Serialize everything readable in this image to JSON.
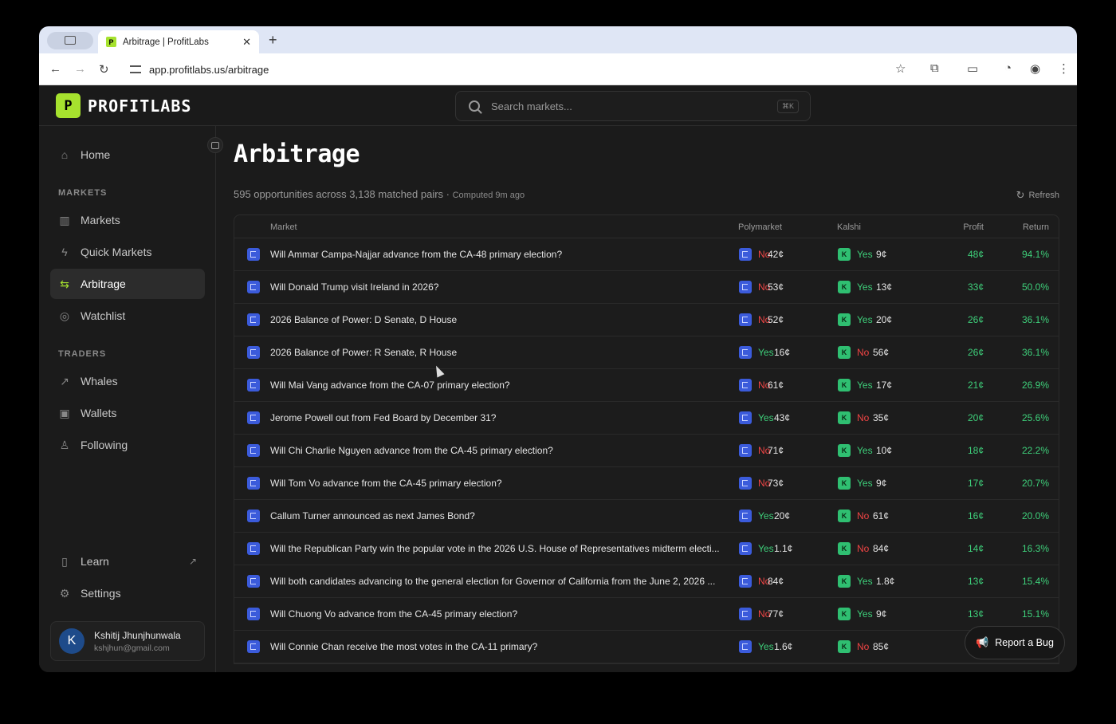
{
  "browser": {
    "tab_title": "Arbitrage | ProfitLabs",
    "favicon_letter": "P",
    "url": "app.profitlabs.us/arbitrage"
  },
  "app": {
    "logo_letter": "P",
    "logo_text": "PROFITLABS",
    "search_placeholder": "Search markets...",
    "search_shortcut": "⌘K",
    "accent_color": "#a6e22e"
  },
  "sidebar": {
    "home": "Home",
    "markets_section": "MARKETS",
    "markets": "Markets",
    "quick_markets": "Quick Markets",
    "arbitrage": "Arbitrage",
    "watchlist": "Watchlist",
    "traders_section": "TRADERS",
    "whales": "Whales",
    "wallets": "Wallets",
    "following": "Following",
    "learn": "Learn",
    "settings": "Settings",
    "user": {
      "initial": "K",
      "name": "Kshitij Jhunjhunwala",
      "email": "kshjhun@gmail.com"
    }
  },
  "main": {
    "title": "Arbitrage",
    "subtitle": "595 opportunities across 3,138 matched pairs",
    "separator": " · ",
    "computed": "Computed 9m ago",
    "refresh": "Refresh",
    "columns": {
      "market": "Market",
      "polymarket": "Polymarket",
      "kalshi": "Kalshi",
      "profit": "Profit",
      "return": "Return"
    },
    "rows": [
      {
        "market": "Will Ammar Campa-Najjar advance from the CA-48 primary election?",
        "pm_side": "No",
        "pm_price": "42¢",
        "k_side": "Yes",
        "k_price": "9¢",
        "profit": "48¢",
        "return": "94.1%"
      },
      {
        "market": "Will Donald Trump visit Ireland in 2026?",
        "pm_side": "No",
        "pm_price": "53¢",
        "k_side": "Yes",
        "k_price": "13¢",
        "profit": "33¢",
        "return": "50.0%"
      },
      {
        "market": "2026 Balance of Power: D Senate, D House",
        "pm_side": "No",
        "pm_price": "52¢",
        "k_side": "Yes",
        "k_price": "20¢",
        "profit": "26¢",
        "return": "36.1%"
      },
      {
        "market": "2026 Balance of Power: R Senate, R House",
        "pm_side": "Yes",
        "pm_price": "16¢",
        "k_side": "No",
        "k_price": "56¢",
        "profit": "26¢",
        "return": "36.1%"
      },
      {
        "market": "Will Mai Vang advance from the CA-07 primary election?",
        "pm_side": "No",
        "pm_price": "61¢",
        "k_side": "Yes",
        "k_price": "17¢",
        "profit": "21¢",
        "return": "26.9%"
      },
      {
        "market": "Jerome Powell out from Fed Board by December 31?",
        "pm_side": "Yes",
        "pm_price": "43¢",
        "k_side": "No",
        "k_price": "35¢",
        "profit": "20¢",
        "return": "25.6%"
      },
      {
        "market": "Will Chi Charlie Nguyen advance from the CA-45 primary election?",
        "pm_side": "No",
        "pm_price": "71¢",
        "k_side": "Yes",
        "k_price": "10¢",
        "profit": "18¢",
        "return": "22.2%"
      },
      {
        "market": "Will Tom Vo advance from the CA-45 primary election?",
        "pm_side": "No",
        "pm_price": "73¢",
        "k_side": "Yes",
        "k_price": "9¢",
        "profit": "17¢",
        "return": "20.7%"
      },
      {
        "market": "Callum Turner announced as next James Bond?",
        "pm_side": "Yes",
        "pm_price": "20¢",
        "k_side": "No",
        "k_price": "61¢",
        "profit": "16¢",
        "return": "20.0%"
      },
      {
        "market": "Will the Republican Party win the popular vote in the 2026 U.S. House of Representatives midterm electi...",
        "pm_side": "Yes",
        "pm_price": "1.1¢",
        "k_side": "No",
        "k_price": "84¢",
        "profit": "14¢",
        "return": "16.3%"
      },
      {
        "market": "Will both candidates advancing to the general election for Governor of California from the June 2, 2026 ...",
        "pm_side": "No",
        "pm_price": "84¢",
        "k_side": "Yes",
        "k_price": "1.8¢",
        "profit": "13¢",
        "return": "15.4%"
      },
      {
        "market": "Will Chuong Vo advance from the CA-45 primary election?",
        "pm_side": "No",
        "pm_price": "77¢",
        "k_side": "Yes",
        "k_price": "9¢",
        "profit": "13¢",
        "return": "15.1%"
      },
      {
        "market": "Will Connie Chan receive the most votes in the CA-11 primary?",
        "pm_side": "Yes",
        "pm_price": "1.6¢",
        "k_side": "No",
        "k_price": "85¢",
        "profit": "",
        "return": ""
      }
    ],
    "kalshi_letter": "K"
  },
  "report_bug": "Report a Bug"
}
